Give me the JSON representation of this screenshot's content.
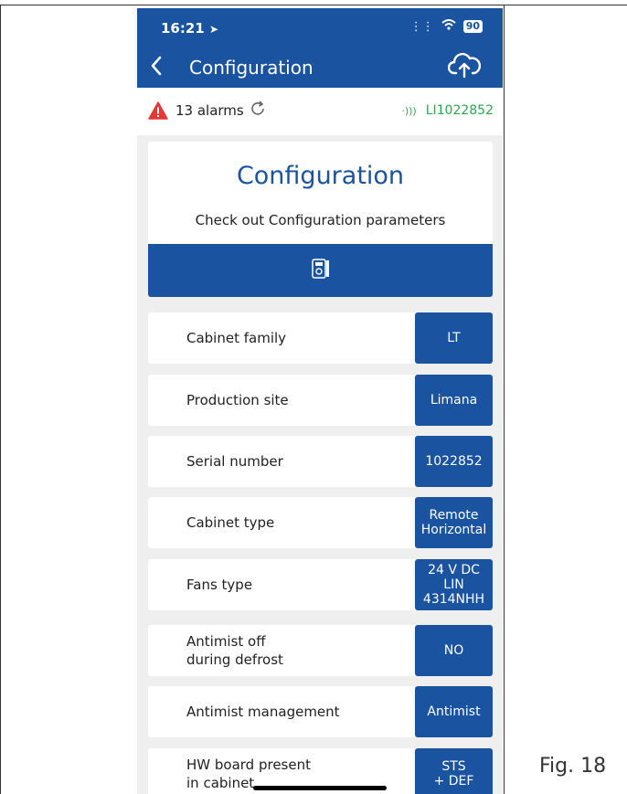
{
  "status_bar": {
    "time": "16:21",
    "battery": "90"
  },
  "header": {
    "title": "Configuration"
  },
  "alarm_bar": {
    "alarm_text": "13 alarms",
    "device_id": "LI1022852"
  },
  "card": {
    "title": "Configuration",
    "subtitle": "Check out Configuration parameters"
  },
  "params": [
    {
      "label": "Cabinet family",
      "value": "LT"
    },
    {
      "label": "Production site",
      "value": "Limana"
    },
    {
      "label": "Serial number",
      "value": "1022852"
    },
    {
      "label": "Cabinet type",
      "value": "Remote\nHorizontal"
    },
    {
      "label": "Fans type",
      "value": "24 V DC\nLIN\n4314NHH"
    },
    {
      "label": "Antimist off\nduring defrost",
      "value": "NO"
    },
    {
      "label": "Antimist management",
      "value": "Antimist"
    },
    {
      "label": "HW board present\nin cabinet",
      "value": "STS\n+ DEF"
    }
  ],
  "figure_label": "Fig. 18",
  "icons": [
    "location-arrow-icon",
    "signal-icon",
    "wifi-icon",
    "back-icon",
    "cloud-upload-icon",
    "warning-icon",
    "refresh-icon",
    "connection-icon",
    "config-device-icon"
  ],
  "colors": {
    "primary": "#1a53a0",
    "connected": "#2fa84f",
    "alarm": "#e53935"
  }
}
